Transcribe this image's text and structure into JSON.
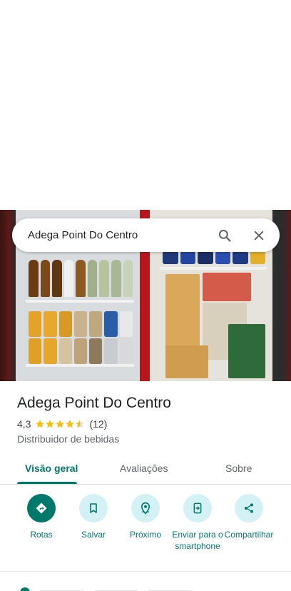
{
  "search": {
    "query": "Adega Point Do Centro"
  },
  "place": {
    "name": "Adega Point Do Centro",
    "rating": "4,3",
    "stars": 4.3,
    "review_count": "(12)",
    "category": "Distribuidor de bebidas"
  },
  "tabs": [
    {
      "label": "Visão geral",
      "active": true
    },
    {
      "label": "Avaliações",
      "active": false
    },
    {
      "label": "Sobre",
      "active": false
    }
  ],
  "actions": [
    {
      "label": "Rotas",
      "icon": "directions-icon"
    },
    {
      "label": "Salvar",
      "icon": "bookmark-icon"
    },
    {
      "label": "Próximo",
      "icon": "nearby-icon"
    },
    {
      "label": "Enviar para o smartphone",
      "icon": "send-to-phone-icon"
    },
    {
      "label": "Compartilhar",
      "icon": "share-icon"
    }
  ],
  "colors": {
    "accent": "#00796b",
    "action_bg": "#d4f1f6",
    "star": "#fbbc04"
  }
}
